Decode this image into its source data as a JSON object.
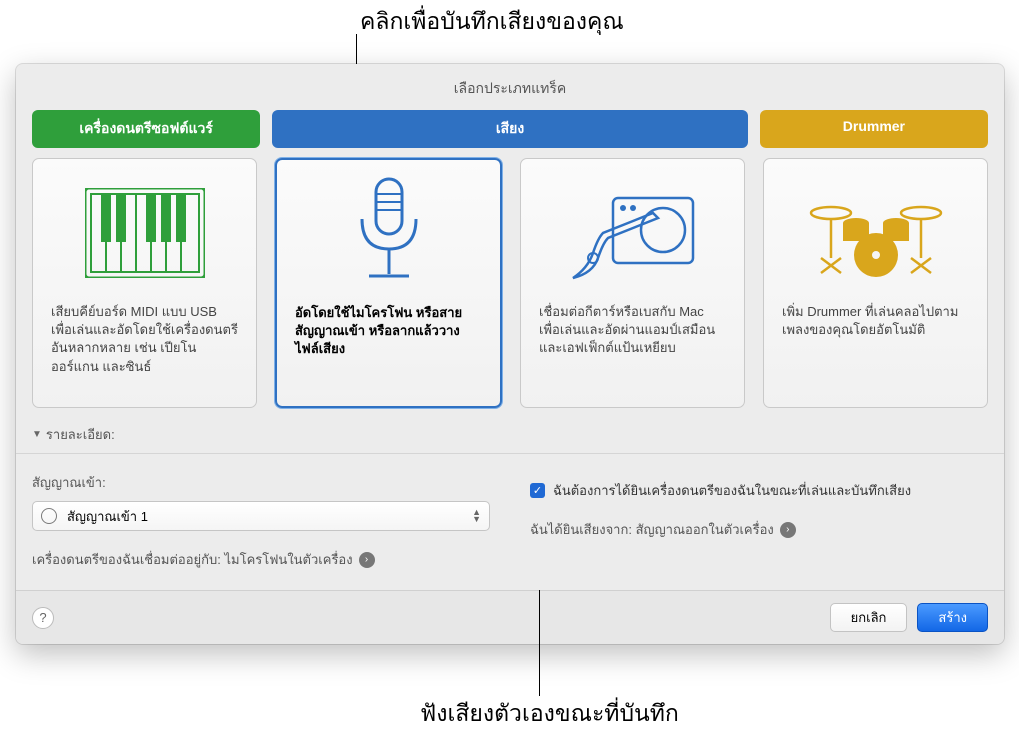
{
  "callouts": {
    "top": "คลิกเพื่อบันทึกเสียงของคุณ",
    "bottom": "ฟังเสียงตัวเองขณะที่บันทึก"
  },
  "dialog": {
    "title": "เลือกประเภทแทร็ค",
    "tabs": {
      "software": "เครื่องดนตรีซอฟต์แวร์",
      "audio": "เสียง",
      "drummer": "Drummer"
    },
    "cards": [
      {
        "desc": "เสียบคีย์บอร์ด MIDI แบบ USB เพื่อเล่นและอัดโดยใช้เครื่องดนตรีอันหลากหลาย เช่น เปียโน ออร์แกน และซินธ์"
      },
      {
        "desc": "อัดโดยใช้ไมโครโฟน หรือสายสัญญาณเข้า หรือลากแล้ววางไฟล์เสียง"
      },
      {
        "desc": "เชื่อมต่อกีตาร์หรือเบสกับ Mac เพื่อเล่นและอัดผ่านแอมป์เสมือนและเอฟเฟ็กต์แป้นเหยียบ"
      },
      {
        "desc": "เพิ่ม Drummer ที่เล่นคลอไปตามเพลงของคุณโดยอัตโนมัติ"
      }
    ],
    "details_label": "รายละเอียด:",
    "input_section": {
      "label": "สัญญาณเข้า:",
      "selected": "สัญญาณเข้า 1",
      "connected": "เครื่องดนตรีของฉันเชื่อมต่ออยู่กับ: ไมโครโฟนในตัวเครื่อง"
    },
    "monitor": {
      "checkbox_label": "ฉันต้องการได้ยินเครื่องดนตรีของฉันในขณะที่เล่นและบันทึกเสียง",
      "hear_from": "ฉันได้ยินเสียงจาก: สัญญาณออกในตัวเครื่อง"
    },
    "footer": {
      "cancel": "ยกเลิก",
      "create": "สร้าง"
    }
  }
}
